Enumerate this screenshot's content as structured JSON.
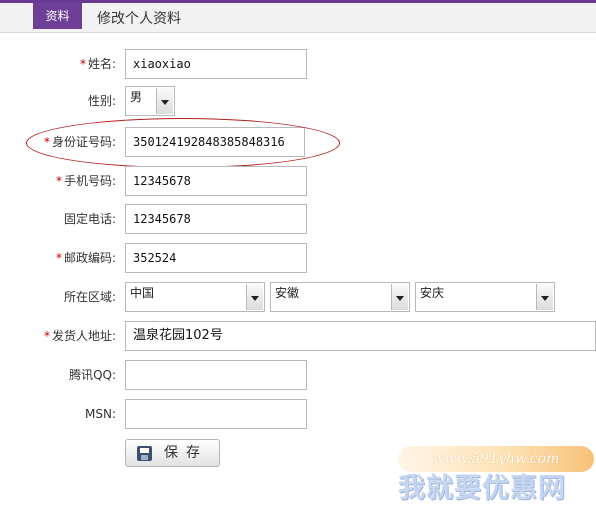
{
  "header": {
    "tab_label": "资料",
    "title": "修改个人资料"
  },
  "form": {
    "name": {
      "label": "姓名:",
      "required": true,
      "value": "xiaoxiao"
    },
    "gender": {
      "label": "性别:",
      "required": false,
      "selected": "男"
    },
    "id_number": {
      "label": "身份证号码:",
      "required": true,
      "value": "350124192848385848316"
    },
    "mobile": {
      "label": "手机号码:",
      "required": true,
      "value": "12345678"
    },
    "phone": {
      "label": "固定电话:",
      "required": false,
      "value": "12345678"
    },
    "postcode": {
      "label": "邮政编码:",
      "required": true,
      "value": "352524"
    },
    "region": {
      "label": "所在区域:",
      "required": false,
      "country": "中国",
      "province": "安徽",
      "city": "安庆"
    },
    "address": {
      "label": "发货人地址:",
      "required": true,
      "value": "温泉花园102号"
    },
    "qq": {
      "label": "腾讯QQ:",
      "required": false,
      "value": ""
    },
    "msn": {
      "label": "MSN:",
      "required": false,
      "value": ""
    },
    "required_mark": "*",
    "save_label": "保存"
  },
  "watermark": {
    "url": "www.591yhw.com",
    "text": "我就要优惠网"
  },
  "colors": {
    "accent": "#6e3f96",
    "highlight_ellipse": "#b02020",
    "required": "#c00000"
  },
  "icons": {
    "save": "floppy-disk-icon",
    "dropdown": "chevron-down-icon"
  }
}
